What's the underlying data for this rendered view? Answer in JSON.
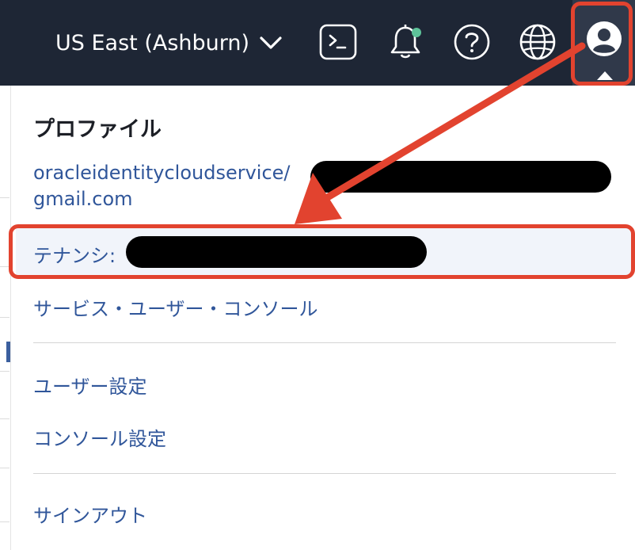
{
  "header": {
    "region_label": "US East (Ashburn)",
    "icons": [
      "terminal-icon",
      "bell-icon",
      "help-icon",
      "globe-icon",
      "profile-icon"
    ],
    "notification_dot_color": "#5ec39a"
  },
  "profile_menu": {
    "title": "プロファイル",
    "account_prefix": "oracleidentitycloudservice/",
    "account_suffix": "gmail.com",
    "tenancy_label": "テナンシ:",
    "items": {
      "service_user_console": "サービス・ユーザー・コンソール",
      "user_settings": "ユーザー設定",
      "console_settings": "コンソール設定",
      "sign_out": "サインアウト"
    }
  },
  "annotation": {
    "highlight_color": "#e2432f"
  }
}
